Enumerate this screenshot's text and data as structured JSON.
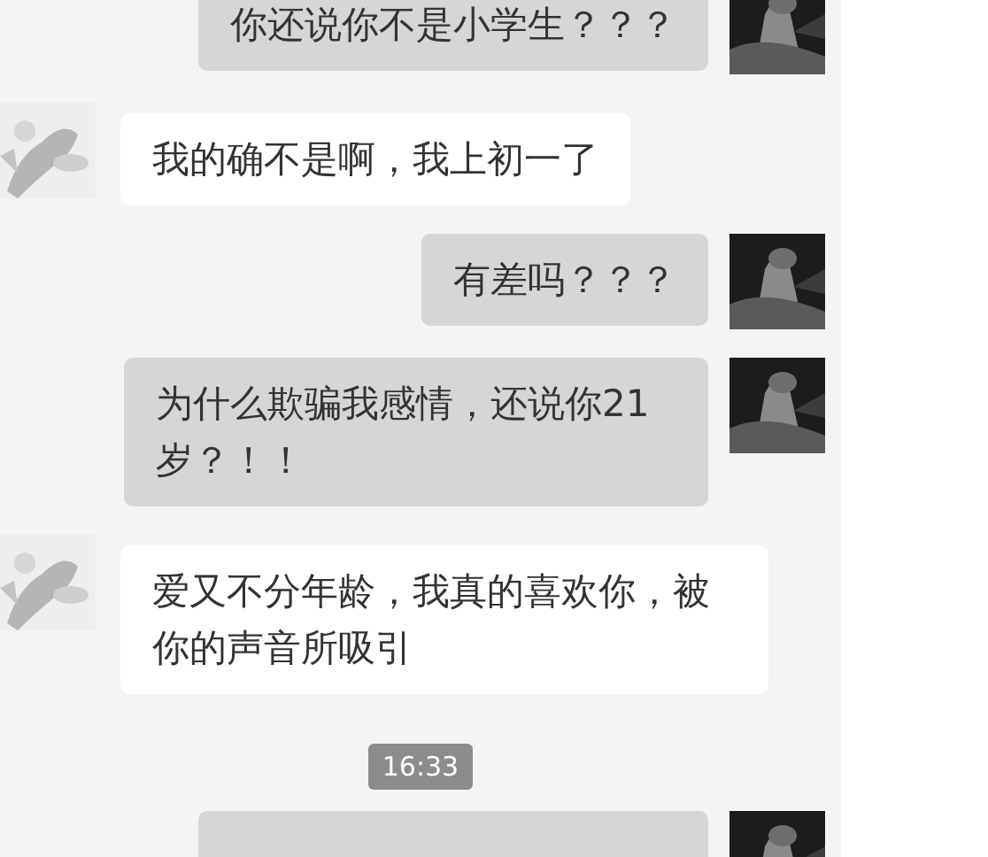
{
  "messages": [
    {
      "kind": "sent",
      "text": "你还说你不是小学生？？？"
    },
    {
      "kind": "received",
      "text": "我的确不是啊，我上初一了"
    },
    {
      "kind": "sent",
      "text": "有差吗？？？"
    },
    {
      "kind": "sent",
      "text": "为什么欺骗我感情，还说你21岁？！！"
    },
    {
      "kind": "received",
      "text": "爱又不分年龄，我真的喜欢你，被你的声音所吸引"
    },
    {
      "kind": "time",
      "text": "16:33"
    },
    {
      "kind": "sent"
    }
  ]
}
